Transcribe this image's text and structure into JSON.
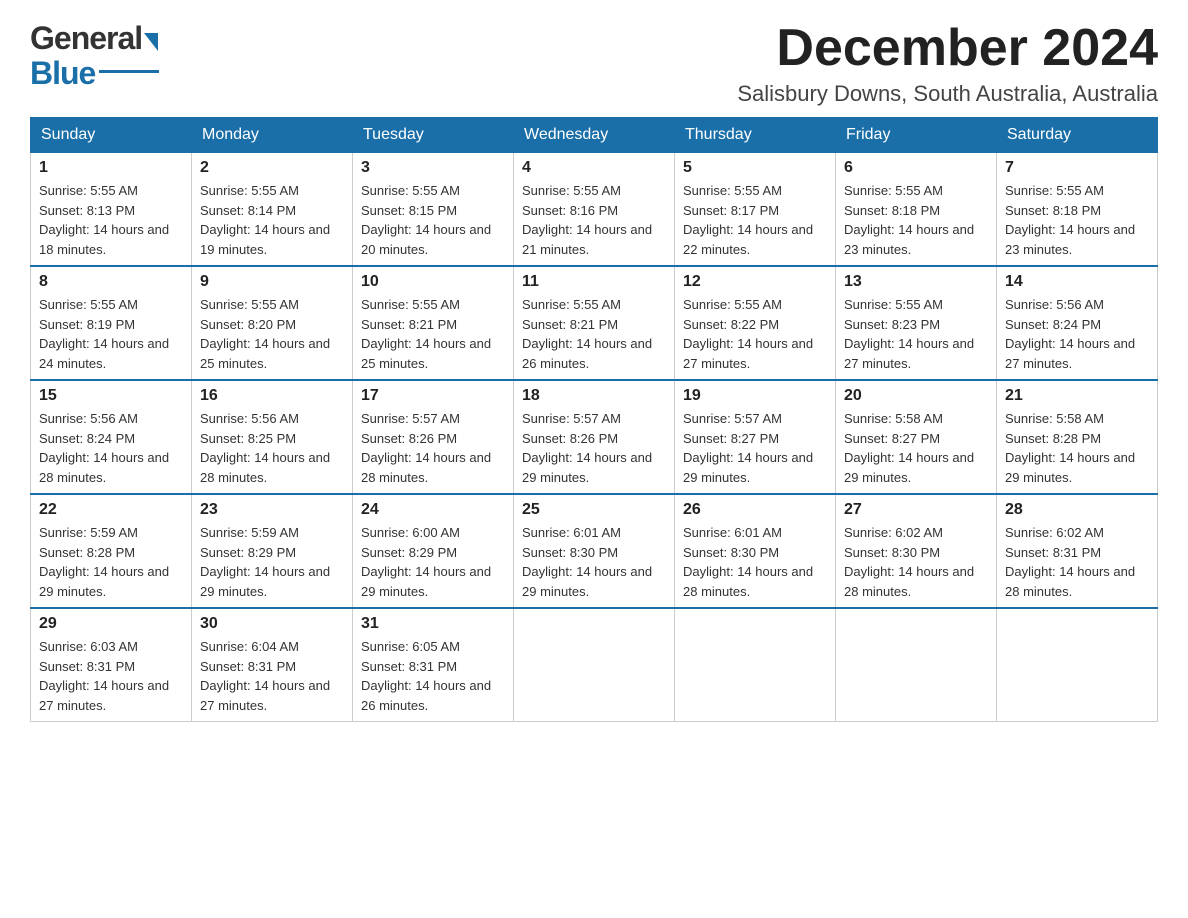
{
  "logo": {
    "text_general": "General",
    "text_blue": "Blue"
  },
  "header": {
    "month_title": "December 2024",
    "location": "Salisbury Downs, South Australia, Australia"
  },
  "days_of_week": [
    "Sunday",
    "Monday",
    "Tuesday",
    "Wednesday",
    "Thursday",
    "Friday",
    "Saturday"
  ],
  "weeks": [
    [
      {
        "day": "1",
        "sunrise": "Sunrise: 5:55 AM",
        "sunset": "Sunset: 8:13 PM",
        "daylight": "Daylight: 14 hours and 18 minutes."
      },
      {
        "day": "2",
        "sunrise": "Sunrise: 5:55 AM",
        "sunset": "Sunset: 8:14 PM",
        "daylight": "Daylight: 14 hours and 19 minutes."
      },
      {
        "day": "3",
        "sunrise": "Sunrise: 5:55 AM",
        "sunset": "Sunset: 8:15 PM",
        "daylight": "Daylight: 14 hours and 20 minutes."
      },
      {
        "day": "4",
        "sunrise": "Sunrise: 5:55 AM",
        "sunset": "Sunset: 8:16 PM",
        "daylight": "Daylight: 14 hours and 21 minutes."
      },
      {
        "day": "5",
        "sunrise": "Sunrise: 5:55 AM",
        "sunset": "Sunset: 8:17 PM",
        "daylight": "Daylight: 14 hours and 22 minutes."
      },
      {
        "day": "6",
        "sunrise": "Sunrise: 5:55 AM",
        "sunset": "Sunset: 8:18 PM",
        "daylight": "Daylight: 14 hours and 23 minutes."
      },
      {
        "day": "7",
        "sunrise": "Sunrise: 5:55 AM",
        "sunset": "Sunset: 8:18 PM",
        "daylight": "Daylight: 14 hours and 23 minutes."
      }
    ],
    [
      {
        "day": "8",
        "sunrise": "Sunrise: 5:55 AM",
        "sunset": "Sunset: 8:19 PM",
        "daylight": "Daylight: 14 hours and 24 minutes."
      },
      {
        "day": "9",
        "sunrise": "Sunrise: 5:55 AM",
        "sunset": "Sunset: 8:20 PM",
        "daylight": "Daylight: 14 hours and 25 minutes."
      },
      {
        "day": "10",
        "sunrise": "Sunrise: 5:55 AM",
        "sunset": "Sunset: 8:21 PM",
        "daylight": "Daylight: 14 hours and 25 minutes."
      },
      {
        "day": "11",
        "sunrise": "Sunrise: 5:55 AM",
        "sunset": "Sunset: 8:21 PM",
        "daylight": "Daylight: 14 hours and 26 minutes."
      },
      {
        "day": "12",
        "sunrise": "Sunrise: 5:55 AM",
        "sunset": "Sunset: 8:22 PM",
        "daylight": "Daylight: 14 hours and 27 minutes."
      },
      {
        "day": "13",
        "sunrise": "Sunrise: 5:55 AM",
        "sunset": "Sunset: 8:23 PM",
        "daylight": "Daylight: 14 hours and 27 minutes."
      },
      {
        "day": "14",
        "sunrise": "Sunrise: 5:56 AM",
        "sunset": "Sunset: 8:24 PM",
        "daylight": "Daylight: 14 hours and 27 minutes."
      }
    ],
    [
      {
        "day": "15",
        "sunrise": "Sunrise: 5:56 AM",
        "sunset": "Sunset: 8:24 PM",
        "daylight": "Daylight: 14 hours and 28 minutes."
      },
      {
        "day": "16",
        "sunrise": "Sunrise: 5:56 AM",
        "sunset": "Sunset: 8:25 PM",
        "daylight": "Daylight: 14 hours and 28 minutes."
      },
      {
        "day": "17",
        "sunrise": "Sunrise: 5:57 AM",
        "sunset": "Sunset: 8:26 PM",
        "daylight": "Daylight: 14 hours and 28 minutes."
      },
      {
        "day": "18",
        "sunrise": "Sunrise: 5:57 AM",
        "sunset": "Sunset: 8:26 PM",
        "daylight": "Daylight: 14 hours and 29 minutes."
      },
      {
        "day": "19",
        "sunrise": "Sunrise: 5:57 AM",
        "sunset": "Sunset: 8:27 PM",
        "daylight": "Daylight: 14 hours and 29 minutes."
      },
      {
        "day": "20",
        "sunrise": "Sunrise: 5:58 AM",
        "sunset": "Sunset: 8:27 PM",
        "daylight": "Daylight: 14 hours and 29 minutes."
      },
      {
        "day": "21",
        "sunrise": "Sunrise: 5:58 AM",
        "sunset": "Sunset: 8:28 PM",
        "daylight": "Daylight: 14 hours and 29 minutes."
      }
    ],
    [
      {
        "day": "22",
        "sunrise": "Sunrise: 5:59 AM",
        "sunset": "Sunset: 8:28 PM",
        "daylight": "Daylight: 14 hours and 29 minutes."
      },
      {
        "day": "23",
        "sunrise": "Sunrise: 5:59 AM",
        "sunset": "Sunset: 8:29 PM",
        "daylight": "Daylight: 14 hours and 29 minutes."
      },
      {
        "day": "24",
        "sunrise": "Sunrise: 6:00 AM",
        "sunset": "Sunset: 8:29 PM",
        "daylight": "Daylight: 14 hours and 29 minutes."
      },
      {
        "day": "25",
        "sunrise": "Sunrise: 6:01 AM",
        "sunset": "Sunset: 8:30 PM",
        "daylight": "Daylight: 14 hours and 29 minutes."
      },
      {
        "day": "26",
        "sunrise": "Sunrise: 6:01 AM",
        "sunset": "Sunset: 8:30 PM",
        "daylight": "Daylight: 14 hours and 28 minutes."
      },
      {
        "day": "27",
        "sunrise": "Sunrise: 6:02 AM",
        "sunset": "Sunset: 8:30 PM",
        "daylight": "Daylight: 14 hours and 28 minutes."
      },
      {
        "day": "28",
        "sunrise": "Sunrise: 6:02 AM",
        "sunset": "Sunset: 8:31 PM",
        "daylight": "Daylight: 14 hours and 28 minutes."
      }
    ],
    [
      {
        "day": "29",
        "sunrise": "Sunrise: 6:03 AM",
        "sunset": "Sunset: 8:31 PM",
        "daylight": "Daylight: 14 hours and 27 minutes."
      },
      {
        "day": "30",
        "sunrise": "Sunrise: 6:04 AM",
        "sunset": "Sunset: 8:31 PM",
        "daylight": "Daylight: 14 hours and 27 minutes."
      },
      {
        "day": "31",
        "sunrise": "Sunrise: 6:05 AM",
        "sunset": "Sunset: 8:31 PM",
        "daylight": "Daylight: 14 hours and 26 minutes."
      },
      null,
      null,
      null,
      null
    ]
  ]
}
